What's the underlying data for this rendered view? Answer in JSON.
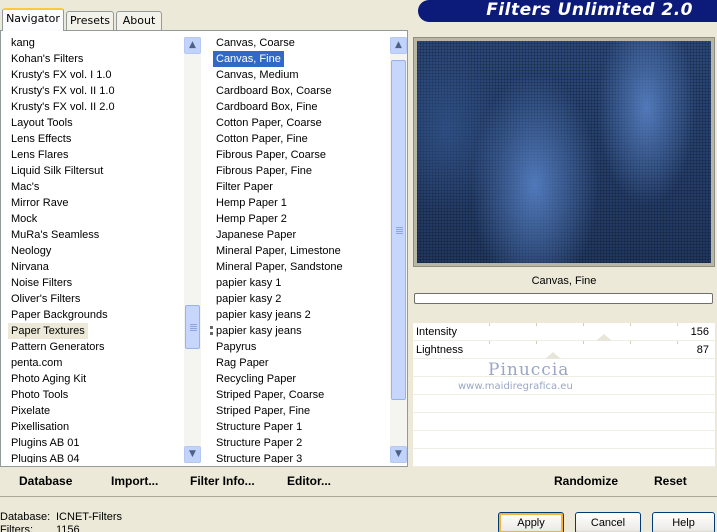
{
  "tabs": [
    {
      "label": "Navigator"
    },
    {
      "label": "Presets"
    },
    {
      "label": "About"
    }
  ],
  "banner": {
    "title": "Filters Unlimited 2.0"
  },
  "categories": {
    "items": [
      "kang",
      "Kohan's Filters",
      "Krusty's FX vol. I 1.0",
      "Krusty's FX vol. II 1.0",
      "Krusty's FX vol. II 2.0",
      "Layout Tools",
      "Lens Effects",
      "Lens Flares",
      "Liquid Silk Filtersut",
      "Mac's",
      "Mirror Rave",
      "Mock",
      "MuRa's Seamless",
      "Neology",
      "Nirvana",
      "Noise Filters",
      "Oliver's Filters",
      "Paper Backgrounds",
      "Paper Textures",
      "Pattern Generators",
      "penta.com",
      "Photo Aging Kit",
      "Photo Tools",
      "Pixelate",
      "Pixellisation",
      "Plugins AB 01",
      "Plugins AB 04"
    ],
    "selected": "Paper Textures"
  },
  "filters": {
    "items": [
      "Canvas, Coarse",
      "Canvas, Fine",
      "Canvas, Medium",
      "Cardboard Box, Coarse",
      "Cardboard Box, Fine",
      "Cotton Paper, Coarse",
      "Cotton Paper, Fine",
      "Fibrous Paper, Coarse",
      "Fibrous Paper, Fine",
      "Filter Paper",
      "Hemp Paper 1",
      "Hemp Paper 2",
      "Japanese Paper",
      "Mineral Paper, Limestone",
      "Mineral Paper, Sandstone",
      "papier kasy 1",
      "papier kasy 2",
      "papier kasy jeans 2",
      "papier kasy jeans",
      "Papyrus",
      "Rag Paper",
      "Recycling Paper",
      "Striped Paper, Coarse",
      "Striped Paper, Fine",
      "Structure Paper 1",
      "Structure Paper 2",
      "Structure Paper 3"
    ],
    "selected": "Canvas, Fine"
  },
  "toolbar": {
    "database": "Database",
    "import": "Import...",
    "filter_info": "Filter Info...",
    "editor": "Editor...",
    "randomize": "Randomize",
    "reset": "Reset"
  },
  "preview": {
    "filter_name": "Canvas, Fine"
  },
  "sliders": [
    {
      "label": "Intensity",
      "value": "156",
      "level": 0.61
    },
    {
      "label": "Lightness",
      "value": "87",
      "level": 0.34
    }
  ],
  "watermark": {
    "name": "Pinuccia",
    "url": "www.maidiregrafica.eu"
  },
  "status": {
    "database_label": "Database:",
    "database_value": "ICNET-Filters",
    "filters_label": "Filters:",
    "filters_value": "1156"
  },
  "buttons": {
    "apply": "Apply",
    "cancel": "Cancel",
    "help": "Help"
  },
  "colors": {
    "selection": "#316ac5",
    "banner": "#0c1a7a",
    "accent": "#ffc83c"
  }
}
